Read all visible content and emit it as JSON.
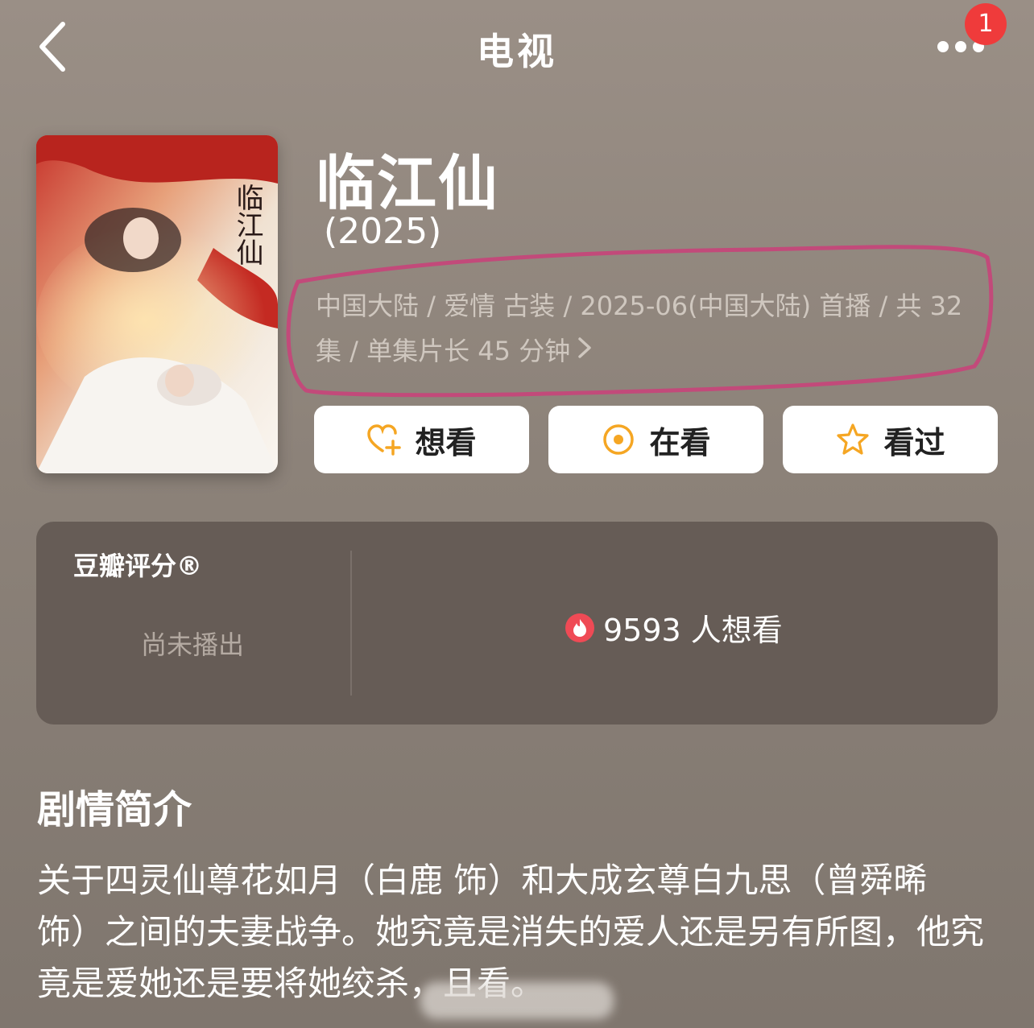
{
  "header": {
    "title": "电视",
    "badge_count": "1"
  },
  "show": {
    "title": "临江仙",
    "year": "(2025)",
    "meta_line1": "中国大陆 / 爱情 古装 / 2025-06(中国大陆) 首播 / 共 32",
    "meta_line2": "集 / 单集片长 45 分钟",
    "poster_title": "临江仙"
  },
  "actions": {
    "want_label": "想看",
    "watching_label": "在看",
    "watched_label": "看过"
  },
  "rating": {
    "label": "豆瓣评分®",
    "status": "尚未播出",
    "want_count_text": "9593 人想看"
  },
  "synopsis": {
    "title": "剧情简介",
    "text": "关于四灵仙尊花如月（白鹿 饰）和大成玄尊白九思（曾舜晞 饰）之间的夫妻战争。她究竟是消失的爱人还是另有所图，他究竟是爱她还是要将她绞杀，且看。"
  },
  "colors": {
    "accent_orange": "#f5a623",
    "badge_red": "#ef3b3b",
    "highlight_pink": "#c24a7a"
  }
}
